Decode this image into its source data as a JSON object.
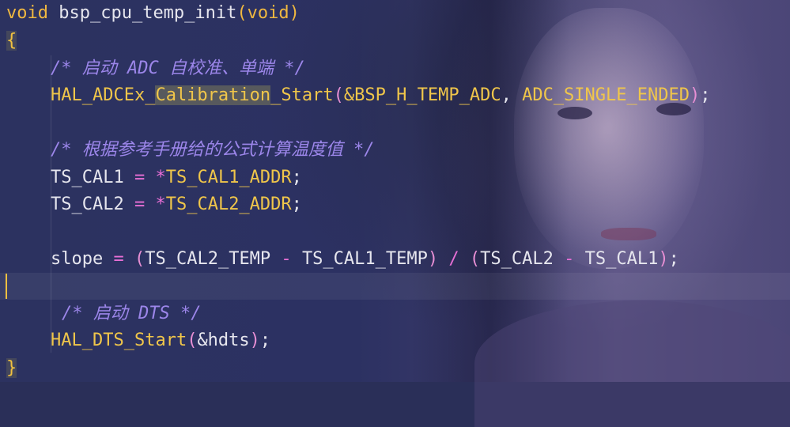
{
  "editor": {
    "code": {
      "l1": {
        "kw": "void",
        "fn": "bsp_cpu_temp_init",
        "p1": "(",
        "arg": "void",
        "p2": ")"
      },
      "l2": {
        "brace": "{"
      },
      "l3": {
        "comment": "/* 启动 ADC 自校准、单端 */"
      },
      "l4": {
        "fn_a": "HAL_ADCEx_",
        "fn_hl": "Calibration",
        "fn_b": "_Start",
        "p1": "(",
        "arg1": "&BSP_H_TEMP_ADC",
        "comma": ", ",
        "arg2": "ADC_SINGLE_ENDED",
        "p2": ")",
        "semi": ";"
      },
      "l6": {
        "comment": "/* 根据参考手册给的公式计算温度值 */"
      },
      "l7": {
        "lhs": "TS_CAL1",
        "eq": " = ",
        "star": "*",
        "rhs": "TS_CAL1_ADDR",
        "semi": ";"
      },
      "l8": {
        "lhs": "TS_CAL2",
        "eq": " = ",
        "star": "*",
        "rhs": "TS_CAL2_ADDR",
        "semi": ";"
      },
      "l10": {
        "lhs": "slope",
        "eq": " = ",
        "p1": "(",
        "a": "TS_CAL2_TEMP",
        "minus1": " - ",
        "b": "TS_CAL1_TEMP",
        "p2": ")",
        "div": " / ",
        "p3": "(",
        "c": "TS_CAL2",
        "minus2": " - ",
        "d": "TS_CAL1",
        "p4": ")",
        "semi": ";"
      },
      "l12": {
        "comment": "/* 启动 DTS */"
      },
      "l13": {
        "fn": "HAL_DTS_Start",
        "p1": "(",
        "arg": "&hdts",
        "p2": ")",
        "semi": ";"
      },
      "l14": {
        "brace": "}"
      }
    },
    "colors": {
      "keyword": "#f0b840",
      "comment": "#9c86ea",
      "operator": "#e86fd6",
      "identifier": "#e6e6ee"
    }
  }
}
